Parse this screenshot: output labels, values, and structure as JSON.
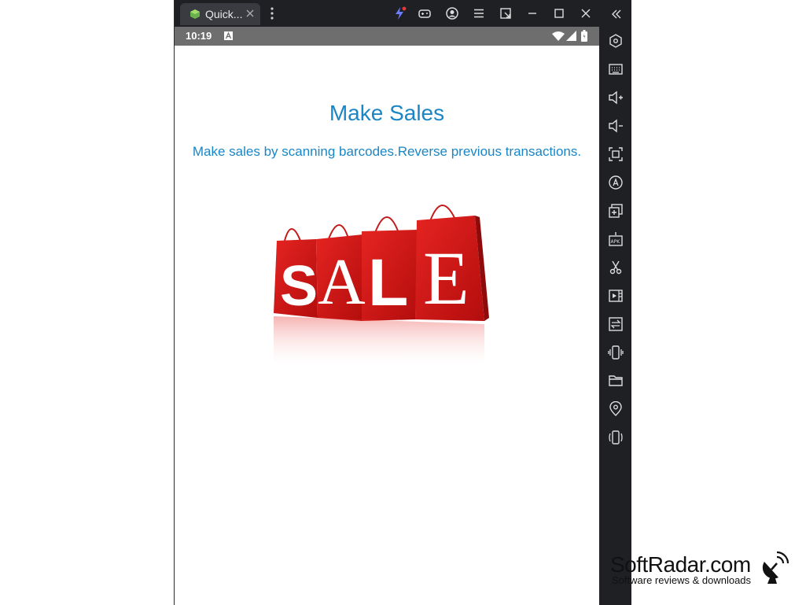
{
  "window": {
    "tab_title": "Quick...",
    "colors": {
      "chrome": "#1f2024",
      "tab": "#3a3b40",
      "statusbar": "#6e6e6e",
      "accent": "#1a86c5",
      "badge": "#e53935"
    }
  },
  "titlebar_icons": [
    "quick-menu-lightning-icon",
    "gamepad-icon",
    "account-icon",
    "menu-icon",
    "exit-screen-icon",
    "minimize-icon",
    "maximize-icon",
    "close-icon",
    "collapse-sidebar-icon"
  ],
  "statusbar": {
    "time": "10:19"
  },
  "app": {
    "title": "Make Sales",
    "subtitle": "Make sales by scanning barcodes.Reverse previous transactions.",
    "image_letters": [
      "S",
      "A",
      "L",
      "E"
    ]
  },
  "sidebar": {
    "icons": [
      "settings-hex-icon",
      "keyboard-icon",
      "volume-up-icon",
      "volume-down-icon",
      "screenshot-icon",
      "rotate-icon",
      "multi-instance-icon",
      "install-apk-icon",
      "scissors-icon",
      "record-video-icon",
      "sync-icon",
      "shake-icon",
      "folder-icon",
      "location-icon",
      "portrait-icon"
    ]
  },
  "watermark": {
    "title": "SoftRadar.com",
    "subtitle": "Software reviews & downloads"
  }
}
